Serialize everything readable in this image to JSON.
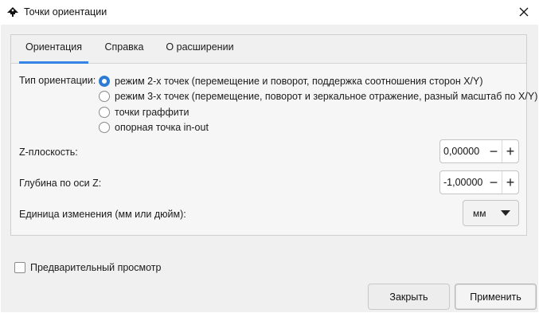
{
  "window": {
    "title": "Точки ориентации"
  },
  "tabs": [
    {
      "label": "Ориентация",
      "active": true
    },
    {
      "label": "Справка",
      "active": false
    },
    {
      "label": "О расширении",
      "active": false
    }
  ],
  "orientation": {
    "label": "Тип ориентации:",
    "options": [
      {
        "label": "режим 2-х точек (перемещение и поворот, поддержка соотношения сторон X/Y)",
        "selected": true
      },
      {
        "label": "режим 3-х точек (перемещение, поворот и зеркальное отражение, разный масштаб по X/Y)",
        "selected": false
      },
      {
        "label": "точки граффити",
        "selected": false
      },
      {
        "label": "опорная точка in-out",
        "selected": false
      }
    ]
  },
  "zplane": {
    "label": "Z-плоскость:",
    "value": "0,00000",
    "minus": "−",
    "plus": "+"
  },
  "zdepth": {
    "label": "Глубина по оси Z:",
    "value": "-1,00000",
    "minus": "−",
    "plus": "+"
  },
  "unit": {
    "label": "Единица изменения (мм или дюйм):",
    "value": "мм"
  },
  "preview": {
    "label": "Предварительный просмотр",
    "checked": false
  },
  "buttons": {
    "close": "Закрыть",
    "apply": "Применить"
  },
  "colors": {
    "accent": "#3584e4"
  }
}
